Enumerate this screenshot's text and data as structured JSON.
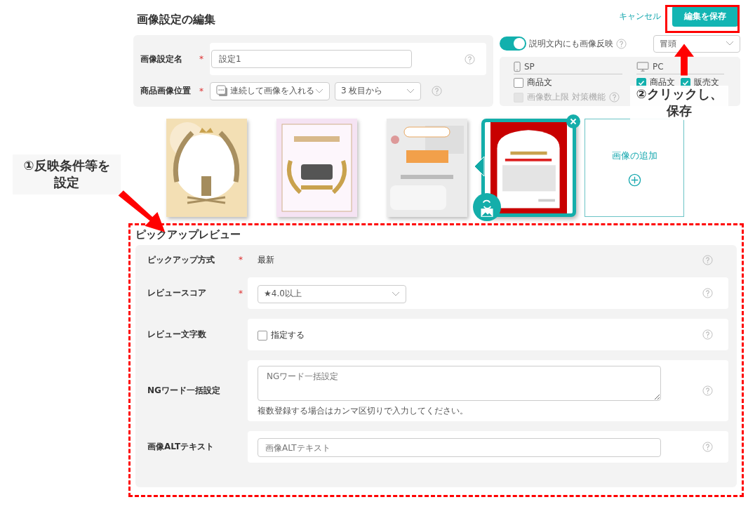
{
  "header": {
    "title": "画像設定の編集",
    "cancel": "キャンセル",
    "save": "編集を保存"
  },
  "settings": {
    "rows": [
      {
        "label": "画像設定名",
        "required": "*",
        "kind": "input",
        "value": "設定1"
      },
      {
        "label": "商品画像位置",
        "required": "*",
        "kind": "selects",
        "selects": [
          "連続して画像を入れる",
          "3 枚目から"
        ]
      }
    ]
  },
  "reflect": {
    "toggle_on": true,
    "label": "説明文内にも画像反映",
    "position": "冒頭",
    "sp": {
      "label": "SP",
      "checkboxes": [
        {
          "label": "商品文",
          "checked": false,
          "disabled": false
        },
        {
          "label": "画像数上限 対策機能",
          "checked": false,
          "disabled": true
        }
      ]
    },
    "pc": {
      "label": "PC",
      "checkboxes": [
        {
          "label": "商品文",
          "checked": true,
          "disabled": false
        },
        {
          "label": "販売文",
          "checked": true,
          "disabled": false
        }
      ]
    }
  },
  "images": [
    {
      "kind": "picture",
      "selected": false
    },
    {
      "kind": "picture",
      "selected": false
    },
    {
      "kind": "picture",
      "selected": false
    },
    {
      "kind": "picture",
      "selected": true
    }
  ],
  "add_image": "画像の追加",
  "pickup": {
    "title": "ピックアップレビュー",
    "rows": [
      {
        "label": "ピックアップ方式",
        "required": "*",
        "kind": "text",
        "value": "最新"
      },
      {
        "label": "レビュースコア",
        "required": "*",
        "kind": "select",
        "value": "★4.0以上"
      },
      {
        "label": "レビュー文字数",
        "kind": "checkbox",
        "checked": false,
        "value": "指定する"
      },
      {
        "label": "NGワード一括設定",
        "kind": "textarea",
        "placeholder": "NGワード一括設定",
        "hint": "複数登録する場合はカンマ区切りで入力してください。"
      },
      {
        "label": "画像ALTテキスト",
        "kind": "input",
        "placeholder": "画像ALTテキスト"
      }
    ]
  },
  "annotations": [
    {
      "text": "①反映条件等を設定"
    },
    {
      "text": "②クリックし、保存"
    }
  ]
}
